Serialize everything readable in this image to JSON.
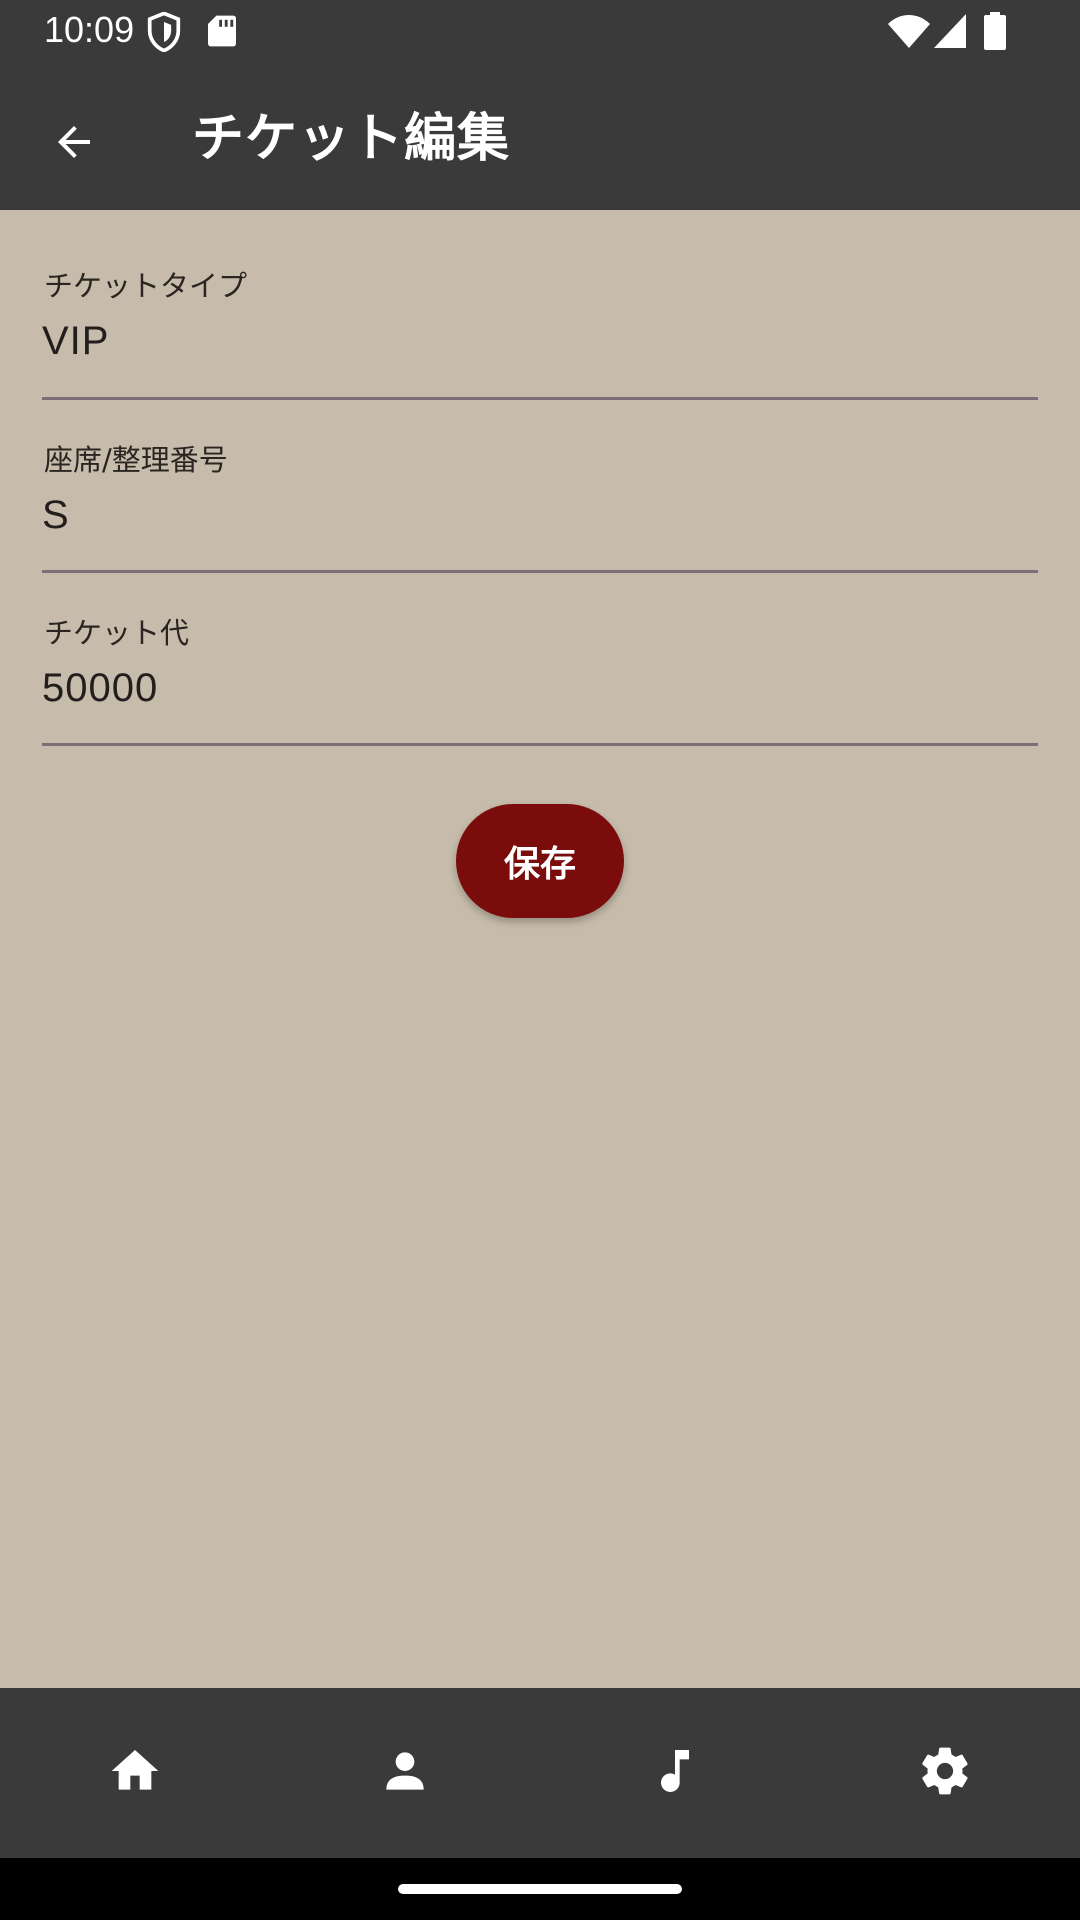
{
  "status_bar": {
    "time": "10:09",
    "left_icons": [
      "shield-icon",
      "sd-card-icon"
    ],
    "right_icons": [
      "wifi-icon",
      "signal-icon",
      "battery-icon"
    ]
  },
  "app_bar": {
    "title": "チケット編集",
    "back_icon": "arrow-back-icon"
  },
  "form": {
    "ticket_type": {
      "label": "チケットタイプ",
      "value": "VIP"
    },
    "seat": {
      "label": "座席/整理番号",
      "value": "S"
    },
    "price": {
      "label": "チケット代",
      "value": "50000"
    }
  },
  "save_button": {
    "label": "保存",
    "color": "#7a0c0c"
  },
  "bottom_nav": {
    "items": [
      {
        "icon": "home-icon"
      },
      {
        "icon": "person-icon"
      },
      {
        "icon": "music-note-icon"
      },
      {
        "icon": "gear-icon"
      }
    ]
  },
  "colors": {
    "bar_background": "#3a3a3a",
    "content_background": "#c7bcab",
    "accent": "#7a0c0c"
  }
}
